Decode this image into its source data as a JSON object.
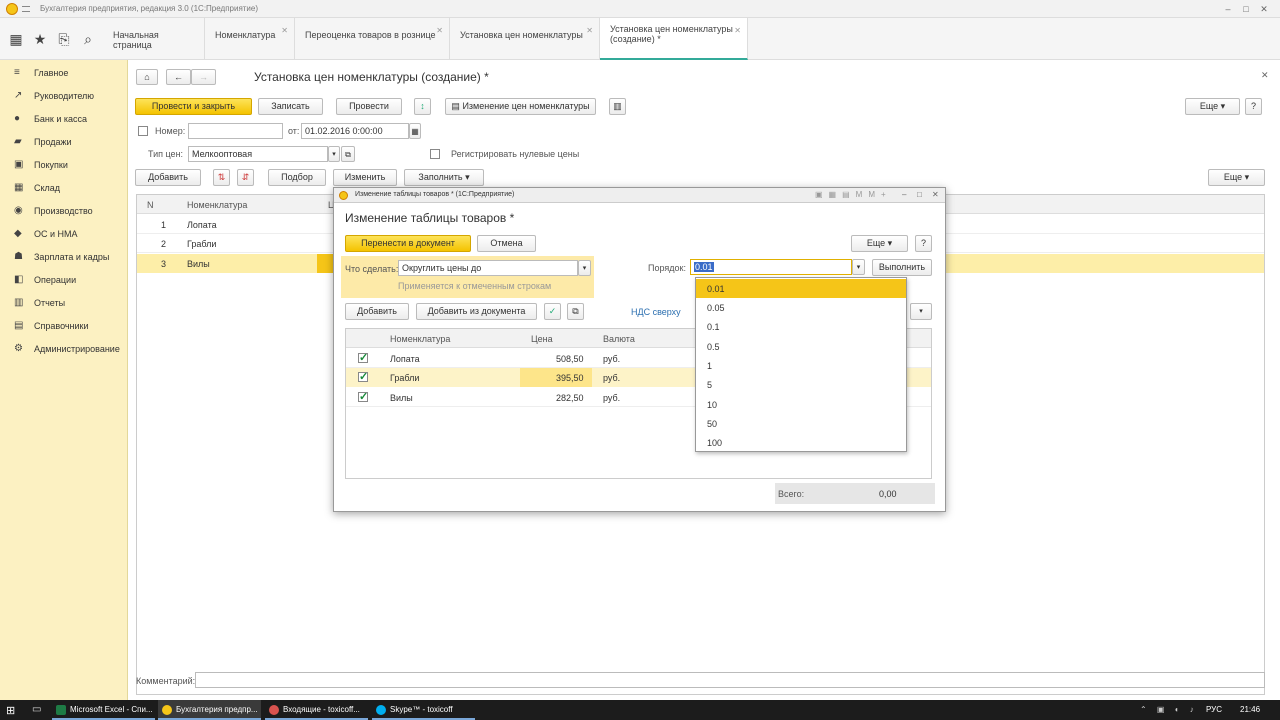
{
  "window": {
    "title": "Бухгалтерия предприятия, редакция 3.0  (1С:Предприятие)"
  },
  "tabs": [
    {
      "label": "Начальная страница"
    },
    {
      "label": "Номенклатура"
    },
    {
      "label": "Переоценка товаров в рознице"
    },
    {
      "label": "Установка цен номенклатуры"
    },
    {
      "label": "Установка цен номенклатуры (создание) *"
    }
  ],
  "sidebar": {
    "items": [
      {
        "label": "Главное",
        "icon": "menu-icon"
      },
      {
        "label": "Руководителю",
        "icon": "chart-icon"
      },
      {
        "label": "Банк и касса",
        "icon": "bank-icon"
      },
      {
        "label": "Продажи",
        "icon": "cart-icon"
      },
      {
        "label": "Покупки",
        "icon": "basket-icon"
      },
      {
        "label": "Склад",
        "icon": "warehouse-icon"
      },
      {
        "label": "Производство",
        "icon": "factory-icon"
      },
      {
        "label": "ОС и НМА",
        "icon": "assets-icon"
      },
      {
        "label": "Зарплата и кадры",
        "icon": "people-icon"
      },
      {
        "label": "Операции",
        "icon": "operations-icon"
      },
      {
        "label": "Отчеты",
        "icon": "reports-icon"
      },
      {
        "label": "Справочники",
        "icon": "book-icon"
      },
      {
        "label": "Администрирование",
        "icon": "gear-icon"
      }
    ]
  },
  "form": {
    "title": "Установка цен номенклатуры (создание) *",
    "post_close": "Провести и закрыть",
    "save": "Записать",
    "post": "Провести",
    "change_prices": "Изменение цен номенклатуры",
    "more": "Еще",
    "number_label": "Номер:",
    "number_value": "",
    "from_label": "от:",
    "date_value": "01.02.2016  0:00:00",
    "price_type_label": "Тип цен:",
    "price_type_value": "Мелкооптовая",
    "zero_prices_label": "Регистрировать нулевые цены",
    "add": "Добавить",
    "pick": "Подбор",
    "change": "Изменить",
    "fill": "Заполнить",
    "more2": "Еще",
    "table_headers": {
      "n": "N",
      "item": "Номенклатура",
      "price_cut": "Ц"
    },
    "rows": [
      {
        "n": "1",
        "item": "Лопата"
      },
      {
        "n": "2",
        "item": "Грабли"
      },
      {
        "n": "3",
        "item": "Вилы"
      }
    ],
    "comment_label": "Комментарий:"
  },
  "dialog": {
    "window_title": "Изменение таблицы товаров *  (1С:Предприятие)",
    "title": "Изменение таблицы товаров *",
    "transfer": "Перенести в документ",
    "cancel": "Отмена",
    "more": "Еще",
    "help": "?",
    "action_label": "Что сделать:",
    "action_value": "Округлить цены до",
    "hint": "Применяется к отмеченным строкам",
    "order_label": "Порядок:",
    "order_value": "0.01",
    "execute": "Выполнить",
    "add": "Добавить",
    "add_from_doc": "Добавить из документа",
    "vat_link": "НДС сверху",
    "headers": {
      "item": "Номенклатура",
      "price": "Цена",
      "currency": "Валюта"
    },
    "rows": [
      {
        "item": "Лопата",
        "price": "508,50",
        "currency": "руб.",
        "checked": true
      },
      {
        "item": "Грабли",
        "price": "395,50",
        "currency": "руб.",
        "checked": true
      },
      {
        "item": "Вилы",
        "price": "282,50",
        "currency": "руб.",
        "checked": true
      }
    ],
    "total_label": "Всего:",
    "total_value": "0,00",
    "dropdown": [
      "0.01",
      "0.05",
      "0.1",
      "0.5",
      "1",
      "5",
      "10",
      "50",
      "100"
    ]
  },
  "taskbar": {
    "items": [
      {
        "label": "Microsoft Excel - Спи..."
      },
      {
        "label": "Бухгалтерия предпр..."
      },
      {
        "label": "Входящие - toxicoff..."
      },
      {
        "label": "Skype™ - toxicoff"
      }
    ],
    "lang": "РУС",
    "time": "21:46"
  }
}
